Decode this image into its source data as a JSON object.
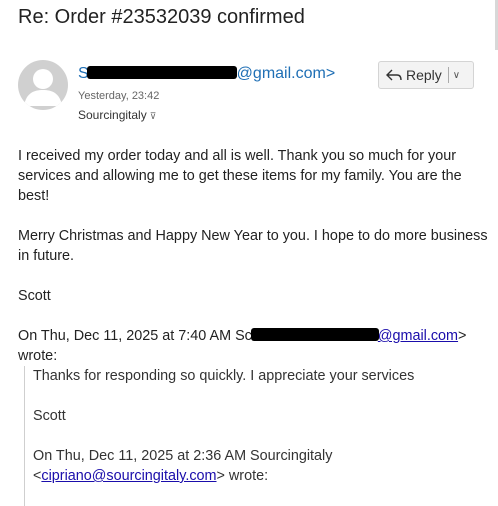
{
  "subject": "Re: Order #23532039 confirmed",
  "sender": {
    "name_initial": "S",
    "email_tail": "@gmail.com>",
    "time": "Yesterday, 23:42",
    "recipient": "Sourcingitaly",
    "avatar_icon": "person-avatar-icon"
  },
  "reply": {
    "label": "Reply",
    "icon": "reply-arrow-icon",
    "dropdown_icon": "chevron-down-icon"
  },
  "body": {
    "para1": "I received my order today and all is well. Thank you so much for your services and allowing me to get these items for my family. You are the best!",
    "para2": "Merry Christmas and Happy New Year to you. I hope to do more business in future.",
    "signoff": "Scott"
  },
  "quote_header": {
    "prefix": "On Thu, Dec 11, 2025 at 7:40 AM ",
    "name_initial": "Sc",
    "email_link": "@gmail.com",
    "suffix_gt": ">",
    "wrote": "wrote:"
  },
  "quoted": {
    "line1": "Thanks for responding so quickly. I appreciate your services",
    "signoff": "Scott",
    "header_prefix": "On Thu, Dec 11, 2025 at 2:36 AM Sourcingitaly",
    "lt": "<",
    "email": "cipriano@sourcingitaly.com",
    "suffix": "> wrote:"
  },
  "colors": {
    "link": "#1f6fb5",
    "quote_link": "#1a0dab",
    "redaction": "#000000"
  }
}
